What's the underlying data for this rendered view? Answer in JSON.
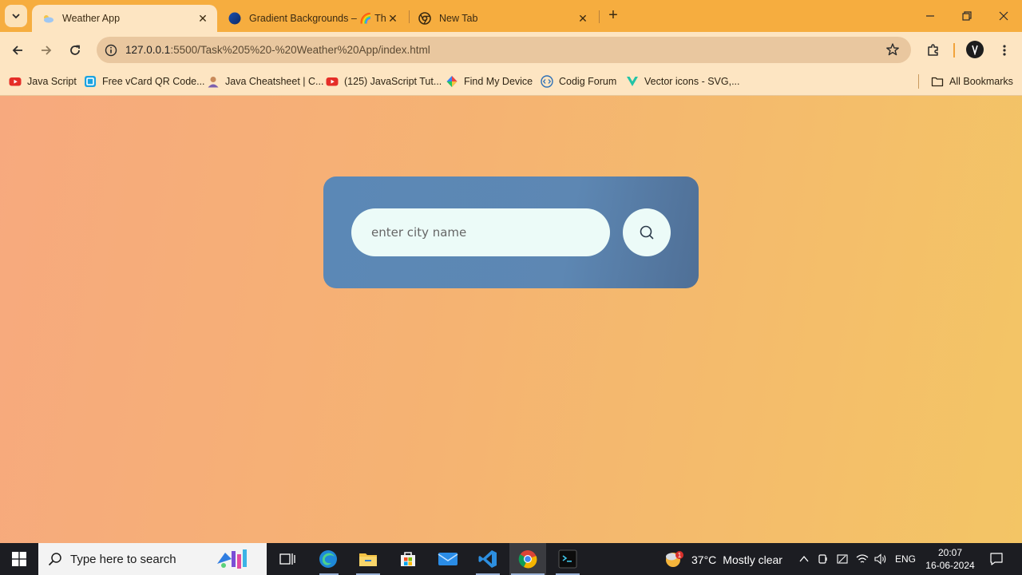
{
  "browser": {
    "tabs": [
      {
        "title": "Weather App",
        "active": true
      },
      {
        "title": "Gradient Backgrounds – 🌈 The",
        "active": false
      },
      {
        "title": "New Tab",
        "active": false
      }
    ],
    "address": {
      "host": "127.0.0.1",
      "path": ":5500/Task%205%20-%20Weather%20App/index.html"
    },
    "bookmarks": [
      {
        "label": "Java Script",
        "icon": "youtube-icon"
      },
      {
        "label": "Free vCard QR Code...",
        "icon": "qr-icon"
      },
      {
        "label": "Java Cheatsheet | C...",
        "icon": "profile-icon"
      },
      {
        "label": "(125) JavaScript Tut...",
        "icon": "youtube-icon"
      },
      {
        "label": "Find My Device",
        "icon": "find-device-icon"
      },
      {
        "label": "Codig Forum",
        "icon": "code-icon"
      },
      {
        "label": "Vector icons - SVG,...",
        "icon": "vector-icon"
      }
    ],
    "all_bookmarks": "All Bookmarks"
  },
  "app": {
    "search_placeholder": "enter city name",
    "search_value": ""
  },
  "taskbar": {
    "search_placeholder": "Type here to search",
    "weather": {
      "temp": "37°C",
      "condition": "Mostly clear",
      "badge": "1"
    },
    "language": "ENG",
    "time": "20:07",
    "date": "16-06-2024"
  },
  "colors": {
    "card_start": "#5b88b6",
    "card_end": "#4f6f96",
    "page_left": "#f7a97e",
    "page_right": "#f3c565",
    "input_bg": "#ecfbf8"
  }
}
